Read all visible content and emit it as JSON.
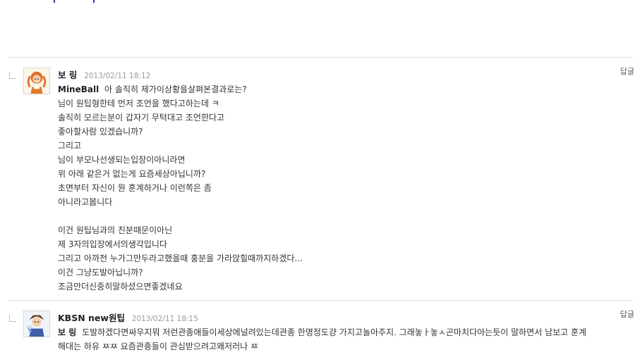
{
  "comments": [
    {
      "author": "보 링",
      "date": "2013/02/11 18:12",
      "reply_label": "답글",
      "mention": "MineBall",
      "lines": [
        "아 솔직히 제가이상황을살펴본결과로는?",
        "님이 원팁형한테 먼저 조언을 했다고하는데 ㅋ",
        "솔직히 모르는분이 갑자기 무턱대고 조언한다고",
        "좋아할사람 있겠습니까?",
        "그리고",
        "님이 부모나선생되는입장이아니라면",
        "위 아래 같은거 없는게 요즘세상아닙니까?",
        "초면부터 자신이 뭔 훈계하거나 이런쪽은 좀",
        "아니라고봅니다",
        "",
        "이건 원팁님과의 친분때문이아닌",
        "제 3자의입장에서의생각입니다",
        "그리고 아까전 누가그만두라고했을때 훙분을 가라앉힐때까지하겠다...",
        "이건 그냥도발아닙니까?",
        "조금만더신중히말하셨으면좋겠네요"
      ],
      "avatar_icon": "girl-character-icon"
    },
    {
      "author": "KBSN new원팁",
      "date": "2013/02/11 18:15",
      "reply_label": "답글",
      "mention": "보 링",
      "lines": [
        "도발하겠다면싸우지뭐 저런관종애들이세상에널려있는데관종 한명정도걍 가지고놀아주지. 그래놓ㅏ놓ㅅ곤마치다아는듯이 말하면서 남보고 훈계",
        "해대는 하유 ㅉㅉ 요즘관종들이 관심받으려고왜저러나 ㅉ"
      ],
      "avatar_icon": "boy-character-icon"
    }
  ],
  "colors": {
    "text": "#333333",
    "author": "#222222",
    "date": "#9a9a9a",
    "separator": "#c8c8c8",
    "top_dots": "#2a3fb0"
  }
}
